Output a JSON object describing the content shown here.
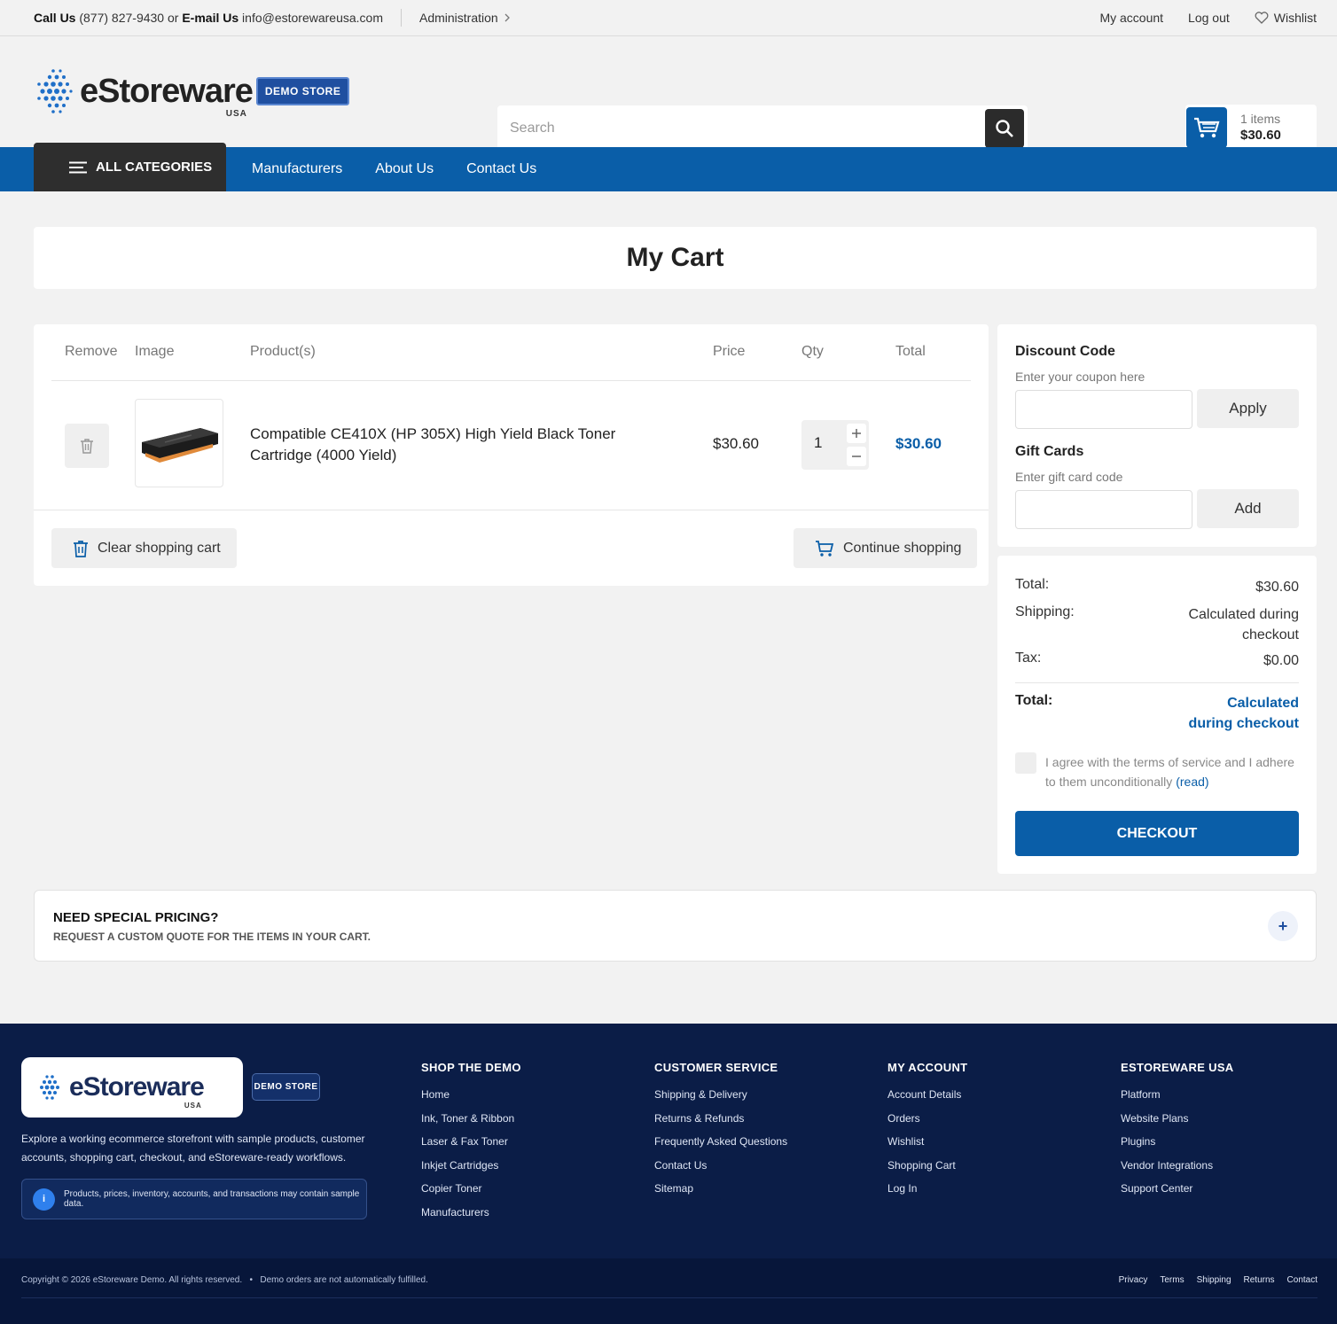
{
  "topbar": {
    "call_label": "Call Us",
    "phone": "(877) 827-9430",
    "or": "or",
    "email_label": "E-mail Us",
    "email": "info@estorewareusa.com",
    "admin": "Administration",
    "my_account": "My account",
    "log_out": "Log out",
    "wishlist": "Wishlist"
  },
  "header": {
    "logo_text": "eStoreware",
    "logo_sub": "USA",
    "badge": "DEMO STORE",
    "search_placeholder": "Search",
    "cart_items": "1 items",
    "cart_total": "$30.60"
  },
  "nav": {
    "all_categories": "ALL CATEGORIES",
    "links": [
      "Manufacturers",
      "About Us",
      "Contact Us"
    ]
  },
  "page_title": "My Cart",
  "cart": {
    "headers": {
      "remove": "Remove",
      "image": "Image",
      "product": "Product(s)",
      "price": "Price",
      "qty": "Qty",
      "total": "Total"
    },
    "item": {
      "name": "Compatible CE410X (HP 305X) High Yield Black Toner Cartridge (4000 Yield)",
      "price": "$30.60",
      "qty": "1",
      "total": "$30.60"
    },
    "clear_label": "Clear shopping cart",
    "continue_label": "Continue shopping"
  },
  "discount": {
    "title": "Discount Code",
    "hint": "Enter your coupon here",
    "apply": "Apply",
    "gift_title": "Gift Cards",
    "gift_hint": "Enter gift card code",
    "add": "Add"
  },
  "summary": {
    "subtotal_label": "Total:",
    "subtotal": "$30.60",
    "shipping_label": "Shipping:",
    "shipping": "Calculated during checkout",
    "tax_label": "Tax:",
    "tax": "$0.00",
    "total_label": "Total:",
    "total": "Calculated during checkout",
    "terms": "I agree with the terms of service and I adhere to them unconditionally",
    "read": "(read)",
    "checkout": "CHECKOUT"
  },
  "special": {
    "title": "NEED SPECIAL PRICING?",
    "subtitle": "REQUEST A CUSTOM QUOTE FOR THE ITEMS IN YOUR CART.",
    "toggle": "+"
  },
  "footer": {
    "logo_text": "eStoreware",
    "logo_sub": "USA",
    "badge": "DEMO STORE",
    "description": "Explore a working ecommerce storefront with sample products, customer accounts, shopping cart, checkout, and eStoreware-ready workflows.",
    "notice_icon": "i",
    "notice": "Products, prices, inventory, accounts, and transactions may contain sample data.",
    "columns": [
      {
        "title": "SHOP THE DEMO",
        "links": [
          "Home",
          "Ink, Toner & Ribbon",
          "Laser & Fax Toner",
          "Inkjet Cartridges",
          "Copier Toner",
          "Manufacturers"
        ]
      },
      {
        "title": "CUSTOMER SERVICE",
        "links": [
          "Shipping & Delivery",
          "Returns & Refunds",
          "Frequently Asked Questions",
          "Contact Us",
          "Sitemap"
        ]
      },
      {
        "title": "MY ACCOUNT",
        "links": [
          "Account Details",
          "Orders",
          "Wishlist",
          "Shopping Cart",
          "Log In"
        ]
      },
      {
        "title": "ESTOREWARE USA",
        "links": [
          "Platform",
          "Website Plans",
          "Plugins",
          "Vendor Integrations",
          "Support Center"
        ]
      }
    ],
    "copyright": "Copyright © 2026 eStoreware Demo. All rights reserved.",
    "bullet": "•",
    "demo_note": "Demo orders are not automatically fulfilled.",
    "bottom_links": [
      "Privacy",
      "Terms",
      "Shipping",
      "Returns",
      "Contact"
    ]
  },
  "colors": {
    "brand_blue": "#0a5ea8",
    "footer_navy": "#0b1d47",
    "dark": "#2e2e2e"
  }
}
